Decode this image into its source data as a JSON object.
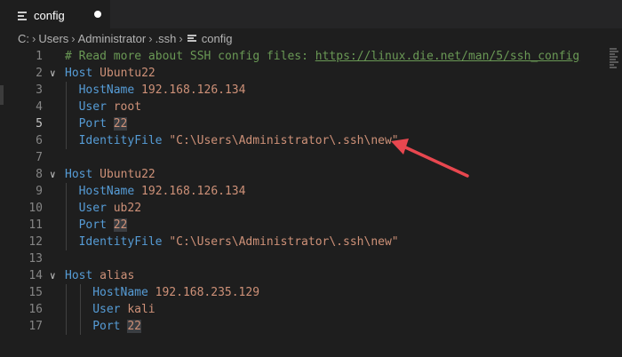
{
  "tab": {
    "label": "config",
    "icon": "lines-icon",
    "unsaved": true
  },
  "breadcrumb": {
    "segments": [
      "C:",
      "Users",
      "Administrator",
      ".ssh",
      "config"
    ],
    "separator": "›"
  },
  "editor": {
    "active_line": 5,
    "lines": [
      {
        "n": "1",
        "tokens": [
          [
            "comment",
            "# Read more about SSH config files: "
          ],
          [
            "link",
            "https://linux.die.net/man/5/ssh_config"
          ]
        ]
      },
      {
        "n": "2",
        "fold": true,
        "tokens": [
          [
            "kw",
            "Host"
          ],
          [
            "plain",
            " "
          ],
          [
            "val",
            "Ubuntu22"
          ]
        ]
      },
      {
        "n": "3",
        "indent": 2,
        "tokens": [
          [
            "kw",
            "HostName"
          ],
          [
            "plain",
            " "
          ],
          [
            "val",
            "192.168.126.134"
          ]
        ]
      },
      {
        "n": "4",
        "indent": 2,
        "tokens": [
          [
            "kw",
            "User"
          ],
          [
            "plain",
            " "
          ],
          [
            "val",
            "root"
          ]
        ]
      },
      {
        "n": "5",
        "indent": 2,
        "tokens": [
          [
            "kw",
            "Port"
          ],
          [
            "plain",
            " "
          ],
          [
            "num",
            "22"
          ]
        ]
      },
      {
        "n": "6",
        "indent": 2,
        "tokens": [
          [
            "kw",
            "IdentityFile"
          ],
          [
            "plain",
            " "
          ],
          [
            "val",
            "\"C:\\Users\\Administrator\\.ssh\\new\""
          ]
        ]
      },
      {
        "n": "7",
        "tokens": []
      },
      {
        "n": "8",
        "fold": true,
        "tokens": [
          [
            "kw",
            "Host"
          ],
          [
            "plain",
            " "
          ],
          [
            "val",
            "Ubuntu22"
          ]
        ]
      },
      {
        "n": "9",
        "indent": 2,
        "tokens": [
          [
            "kw",
            "HostName"
          ],
          [
            "plain",
            " "
          ],
          [
            "val",
            "192.168.126.134"
          ]
        ]
      },
      {
        "n": "10",
        "indent": 2,
        "tokens": [
          [
            "kw",
            "User"
          ],
          [
            "plain",
            " "
          ],
          [
            "val",
            "ub22"
          ]
        ]
      },
      {
        "n": "11",
        "indent": 2,
        "tokens": [
          [
            "kw",
            "Port"
          ],
          [
            "plain",
            " "
          ],
          [
            "num",
            "22"
          ]
        ]
      },
      {
        "n": "12",
        "indent": 2,
        "tokens": [
          [
            "kw",
            "IdentityFile"
          ],
          [
            "plain",
            " "
          ],
          [
            "val",
            "\"C:\\Users\\Administrator\\.ssh\\new\""
          ]
        ]
      },
      {
        "n": "13",
        "tokens": []
      },
      {
        "n": "14",
        "fold": true,
        "tokens": [
          [
            "kw",
            "Host"
          ],
          [
            "plain",
            " "
          ],
          [
            "val",
            "alias"
          ]
        ]
      },
      {
        "n": "15",
        "indent": 4,
        "tokens": [
          [
            "kw",
            "HostName"
          ],
          [
            "plain",
            " "
          ],
          [
            "val",
            "192.168.235.129"
          ]
        ]
      },
      {
        "n": "16",
        "indent": 4,
        "tokens": [
          [
            "kw",
            "User"
          ],
          [
            "plain",
            " "
          ],
          [
            "val",
            "kali"
          ]
        ]
      },
      {
        "n": "17",
        "indent": 4,
        "tokens": [
          [
            "kw",
            "Port"
          ],
          [
            "plain",
            " "
          ],
          [
            "num",
            "22"
          ]
        ]
      }
    ]
  },
  "colors": {
    "background": "#1e1e1e",
    "keyword": "#569cd6",
    "value": "#ce9178",
    "comment": "#6a9955",
    "annotation_arrow": "#e8474f"
  }
}
